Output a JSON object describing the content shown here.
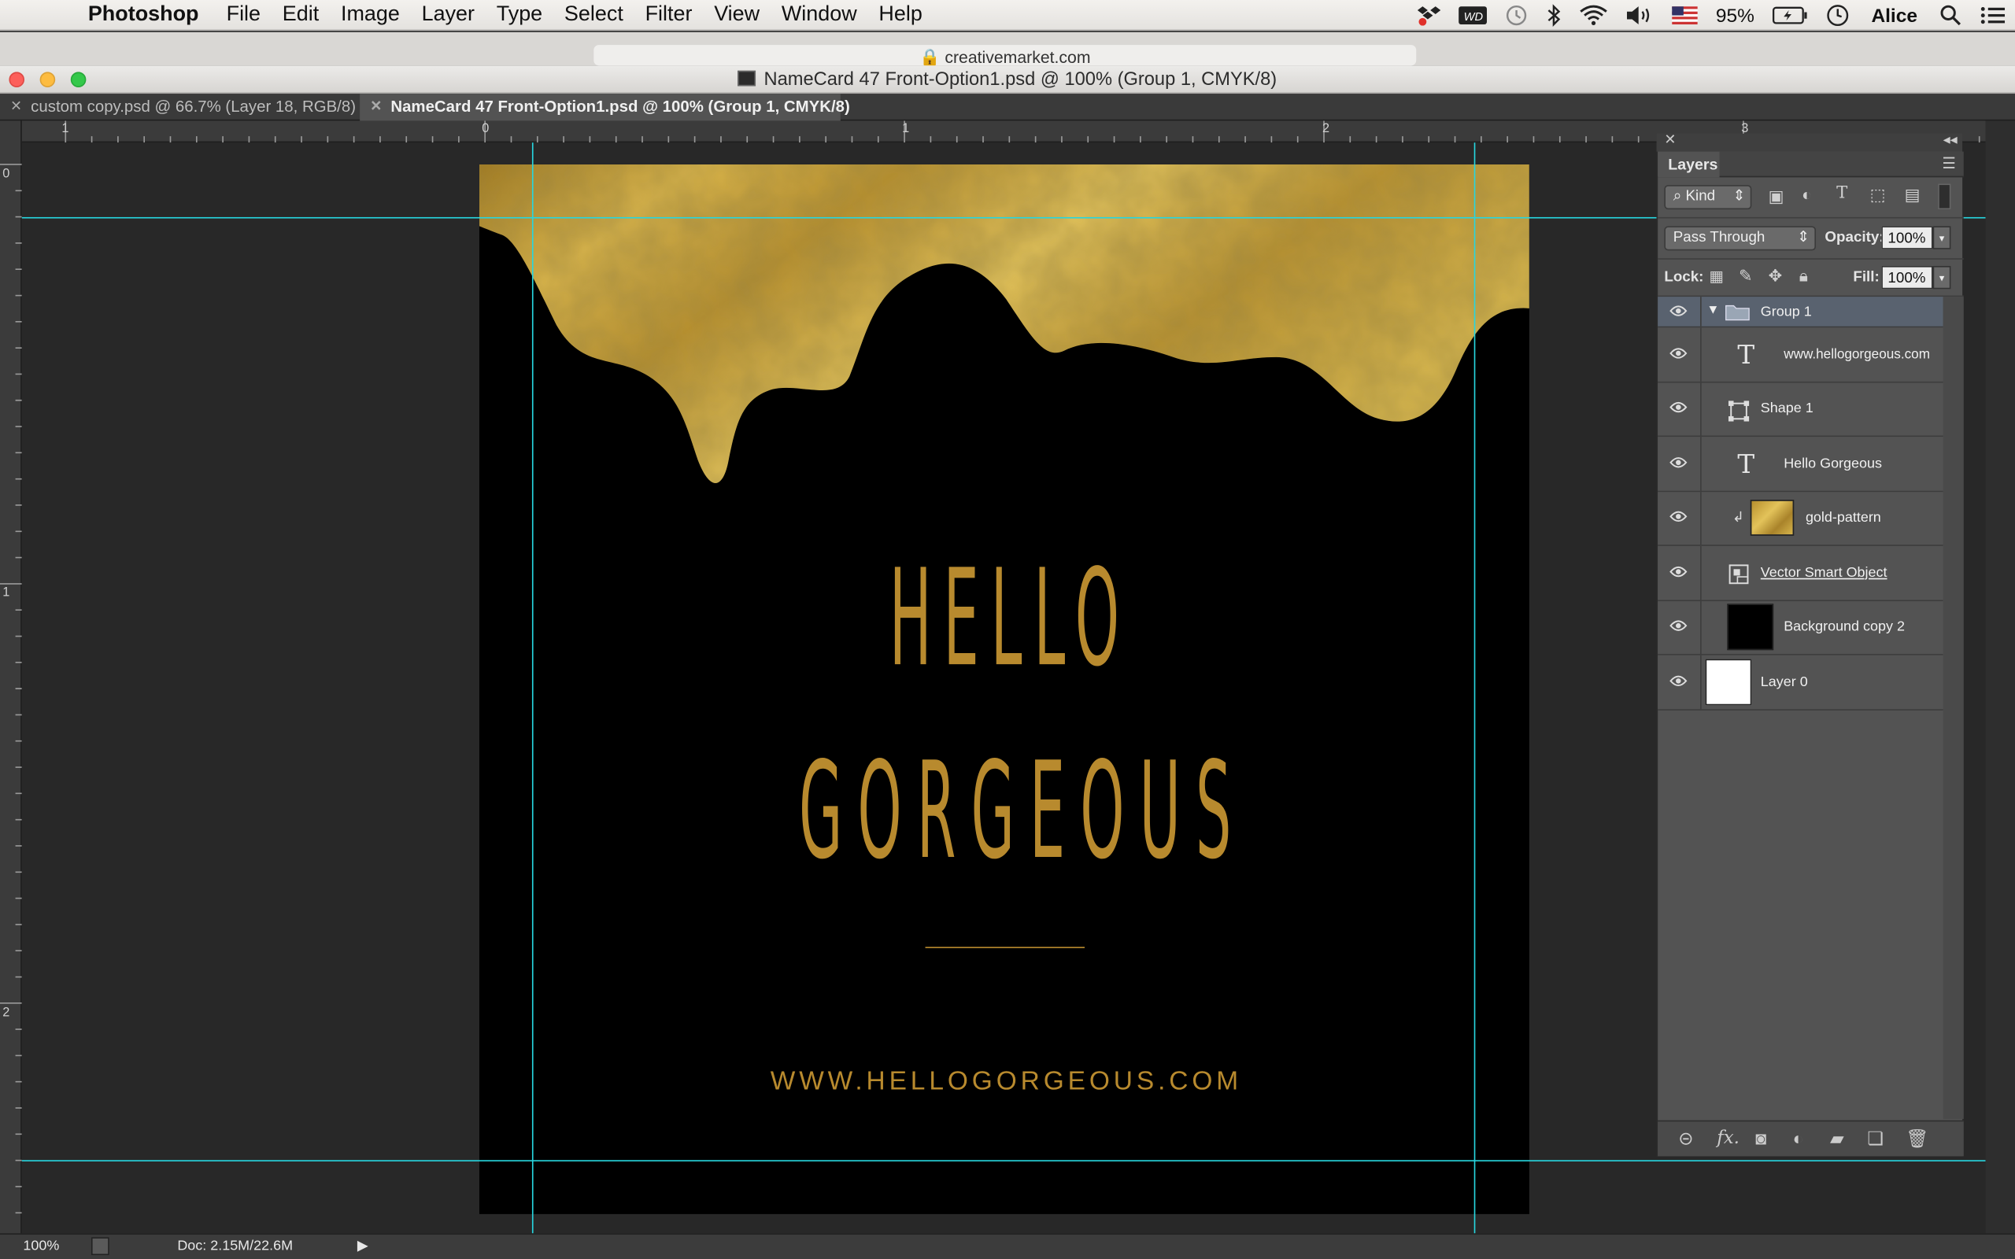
{
  "menubar": {
    "app": "Photoshop",
    "items": [
      "File",
      "Edit",
      "Image",
      "Layer",
      "Type",
      "Select",
      "Filter",
      "View",
      "Window",
      "Help"
    ],
    "battery": "95%",
    "user": "Alice"
  },
  "browser": {
    "address": "creativemarket.com"
  },
  "window": {
    "title": "NameCard 47 Front-Option1.psd @ 100% (Group 1, CMYK/8)"
  },
  "tabs": [
    {
      "label": "custom copy.psd @ 66.7% (Layer 18, RGB/8)"
    },
    {
      "label": "NameCard 47 Front-Option1.psd @ 100% (Group 1, CMYK/8)"
    }
  ],
  "rulers": {
    "h": [
      "1",
      "0",
      "1",
      "2",
      "3"
    ],
    "v": [
      "0",
      "1",
      "2"
    ]
  },
  "document": {
    "line1": "HELLO",
    "line2": "GORGEOUS",
    "url": "WWW.HELLOGORGEOUS.COM",
    "accent": "#b88a2e"
  },
  "layers_panel": {
    "tab": "Layers",
    "filter": "Kind",
    "blend_mode": "Pass Through",
    "opacity_label": "Opacity:",
    "opacity": "100%",
    "lock_label": "Lock:",
    "fill_label": "Fill:",
    "fill": "100%",
    "layers": [
      {
        "name": "Group 1",
        "type": "group"
      },
      {
        "name": "www.hellogorgeous.com",
        "type": "text"
      },
      {
        "name": "Shape 1",
        "type": "shape"
      },
      {
        "name": "Hello Gorgeous",
        "type": "text"
      },
      {
        "name": "gold-pattern",
        "type": "image"
      },
      {
        "name": "Vector Smart Object",
        "type": "smart"
      },
      {
        "name": "Background copy 2",
        "type": "fill-black"
      },
      {
        "name": "Layer 0",
        "type": "fill-white"
      }
    ]
  },
  "statusbar": {
    "zoom": "100%",
    "doc": "Doc: 2.15M/22.6M"
  }
}
